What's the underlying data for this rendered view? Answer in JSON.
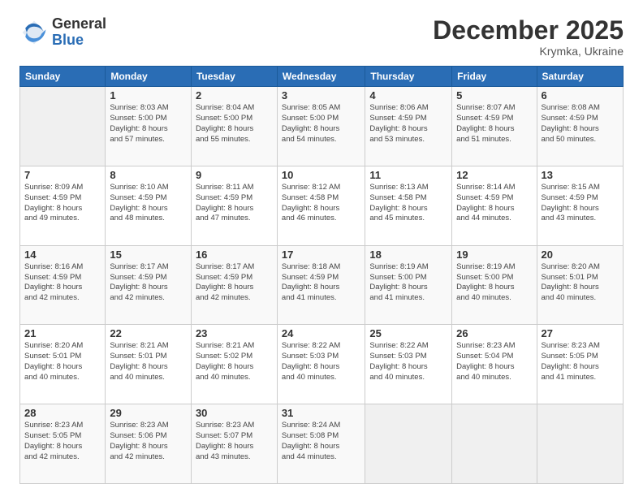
{
  "header": {
    "logo_general": "General",
    "logo_blue": "Blue",
    "month_title": "December 2025",
    "subtitle": "Krymka, Ukraine"
  },
  "days_of_week": [
    "Sunday",
    "Monday",
    "Tuesday",
    "Wednesday",
    "Thursday",
    "Friday",
    "Saturday"
  ],
  "weeks": [
    [
      {
        "day": "",
        "info": ""
      },
      {
        "day": "1",
        "info": "Sunrise: 8:03 AM\nSunset: 5:00 PM\nDaylight: 8 hours\nand 57 minutes."
      },
      {
        "day": "2",
        "info": "Sunrise: 8:04 AM\nSunset: 5:00 PM\nDaylight: 8 hours\nand 55 minutes."
      },
      {
        "day": "3",
        "info": "Sunrise: 8:05 AM\nSunset: 5:00 PM\nDaylight: 8 hours\nand 54 minutes."
      },
      {
        "day": "4",
        "info": "Sunrise: 8:06 AM\nSunset: 4:59 PM\nDaylight: 8 hours\nand 53 minutes."
      },
      {
        "day": "5",
        "info": "Sunrise: 8:07 AM\nSunset: 4:59 PM\nDaylight: 8 hours\nand 51 minutes."
      },
      {
        "day": "6",
        "info": "Sunrise: 8:08 AM\nSunset: 4:59 PM\nDaylight: 8 hours\nand 50 minutes."
      }
    ],
    [
      {
        "day": "7",
        "info": "Sunrise: 8:09 AM\nSunset: 4:59 PM\nDaylight: 8 hours\nand 49 minutes."
      },
      {
        "day": "8",
        "info": "Sunrise: 8:10 AM\nSunset: 4:59 PM\nDaylight: 8 hours\nand 48 minutes."
      },
      {
        "day": "9",
        "info": "Sunrise: 8:11 AM\nSunset: 4:59 PM\nDaylight: 8 hours\nand 47 minutes."
      },
      {
        "day": "10",
        "info": "Sunrise: 8:12 AM\nSunset: 4:58 PM\nDaylight: 8 hours\nand 46 minutes."
      },
      {
        "day": "11",
        "info": "Sunrise: 8:13 AM\nSunset: 4:58 PM\nDaylight: 8 hours\nand 45 minutes."
      },
      {
        "day": "12",
        "info": "Sunrise: 8:14 AM\nSunset: 4:59 PM\nDaylight: 8 hours\nand 44 minutes."
      },
      {
        "day": "13",
        "info": "Sunrise: 8:15 AM\nSunset: 4:59 PM\nDaylight: 8 hours\nand 43 minutes."
      }
    ],
    [
      {
        "day": "14",
        "info": "Sunrise: 8:16 AM\nSunset: 4:59 PM\nDaylight: 8 hours\nand 42 minutes."
      },
      {
        "day": "15",
        "info": "Sunrise: 8:17 AM\nSunset: 4:59 PM\nDaylight: 8 hours\nand 42 minutes."
      },
      {
        "day": "16",
        "info": "Sunrise: 8:17 AM\nSunset: 4:59 PM\nDaylight: 8 hours\nand 42 minutes."
      },
      {
        "day": "17",
        "info": "Sunrise: 8:18 AM\nSunset: 4:59 PM\nDaylight: 8 hours\nand 41 minutes."
      },
      {
        "day": "18",
        "info": "Sunrise: 8:19 AM\nSunset: 5:00 PM\nDaylight: 8 hours\nand 41 minutes."
      },
      {
        "day": "19",
        "info": "Sunrise: 8:19 AM\nSunset: 5:00 PM\nDaylight: 8 hours\nand 40 minutes."
      },
      {
        "day": "20",
        "info": "Sunrise: 8:20 AM\nSunset: 5:01 PM\nDaylight: 8 hours\nand 40 minutes."
      }
    ],
    [
      {
        "day": "21",
        "info": "Sunrise: 8:20 AM\nSunset: 5:01 PM\nDaylight: 8 hours\nand 40 minutes."
      },
      {
        "day": "22",
        "info": "Sunrise: 8:21 AM\nSunset: 5:01 PM\nDaylight: 8 hours\nand 40 minutes."
      },
      {
        "day": "23",
        "info": "Sunrise: 8:21 AM\nSunset: 5:02 PM\nDaylight: 8 hours\nand 40 minutes."
      },
      {
        "day": "24",
        "info": "Sunrise: 8:22 AM\nSunset: 5:03 PM\nDaylight: 8 hours\nand 40 minutes."
      },
      {
        "day": "25",
        "info": "Sunrise: 8:22 AM\nSunset: 5:03 PM\nDaylight: 8 hours\nand 40 minutes."
      },
      {
        "day": "26",
        "info": "Sunrise: 8:23 AM\nSunset: 5:04 PM\nDaylight: 8 hours\nand 40 minutes."
      },
      {
        "day": "27",
        "info": "Sunrise: 8:23 AM\nSunset: 5:05 PM\nDaylight: 8 hours\nand 41 minutes."
      }
    ],
    [
      {
        "day": "28",
        "info": "Sunrise: 8:23 AM\nSunset: 5:05 PM\nDaylight: 8 hours\nand 42 minutes."
      },
      {
        "day": "29",
        "info": "Sunrise: 8:23 AM\nSunset: 5:06 PM\nDaylight: 8 hours\nand 42 minutes."
      },
      {
        "day": "30",
        "info": "Sunrise: 8:23 AM\nSunset: 5:07 PM\nDaylight: 8 hours\nand 43 minutes."
      },
      {
        "day": "31",
        "info": "Sunrise: 8:24 AM\nSunset: 5:08 PM\nDaylight: 8 hours\nand 44 minutes."
      },
      {
        "day": "",
        "info": ""
      },
      {
        "day": "",
        "info": ""
      },
      {
        "day": "",
        "info": ""
      }
    ]
  ]
}
